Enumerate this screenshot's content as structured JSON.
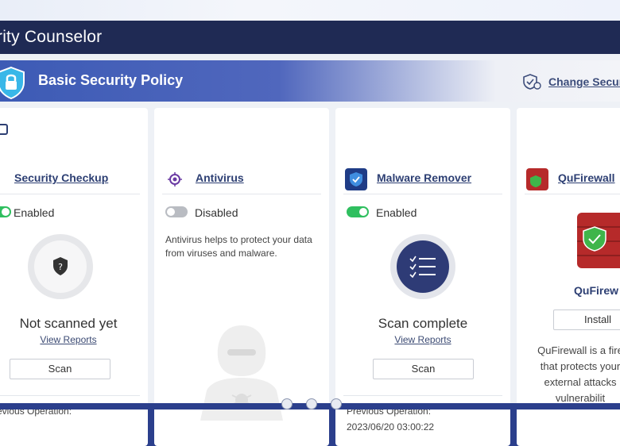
{
  "window": {
    "title": "rity Counselor"
  },
  "banner": {
    "title": "Basic Security Policy",
    "change_label": "Change Secur"
  },
  "cards": {
    "security_checkup": {
      "title": "Security Checkup",
      "state": "Enabled",
      "status": "Not scanned yet",
      "view_reports": "View Reports",
      "scan": "Scan",
      "prev_label": "evious Operation:"
    },
    "antivirus": {
      "title": "Antivirus",
      "state": "Disabled",
      "description_line1": "Antivirus helps to protect your data",
      "description_line2": "from viruses and malware."
    },
    "malware_remover": {
      "title": "Malware Remover",
      "state": "Enabled",
      "status": "Scan complete",
      "view_reports": "View Reports",
      "scan": "Scan",
      "prev_label": "Previous Operation:",
      "prev_time": "2023/06/20 03:00:22"
    },
    "qufirewall": {
      "title": "QuFirewall",
      "name": "QuFirew",
      "install": "Install",
      "desc_line1": "QuFirewall is a fire",
      "desc_line2": "that protects your",
      "desc_line3": "external attacks",
      "desc_line4": "vulnerabilit"
    }
  },
  "colors": {
    "accent": "#2d3f73",
    "enabled": "#2fbf5f",
    "disabled": "#b9bcc2",
    "titlebar": "#1f2a54"
  }
}
